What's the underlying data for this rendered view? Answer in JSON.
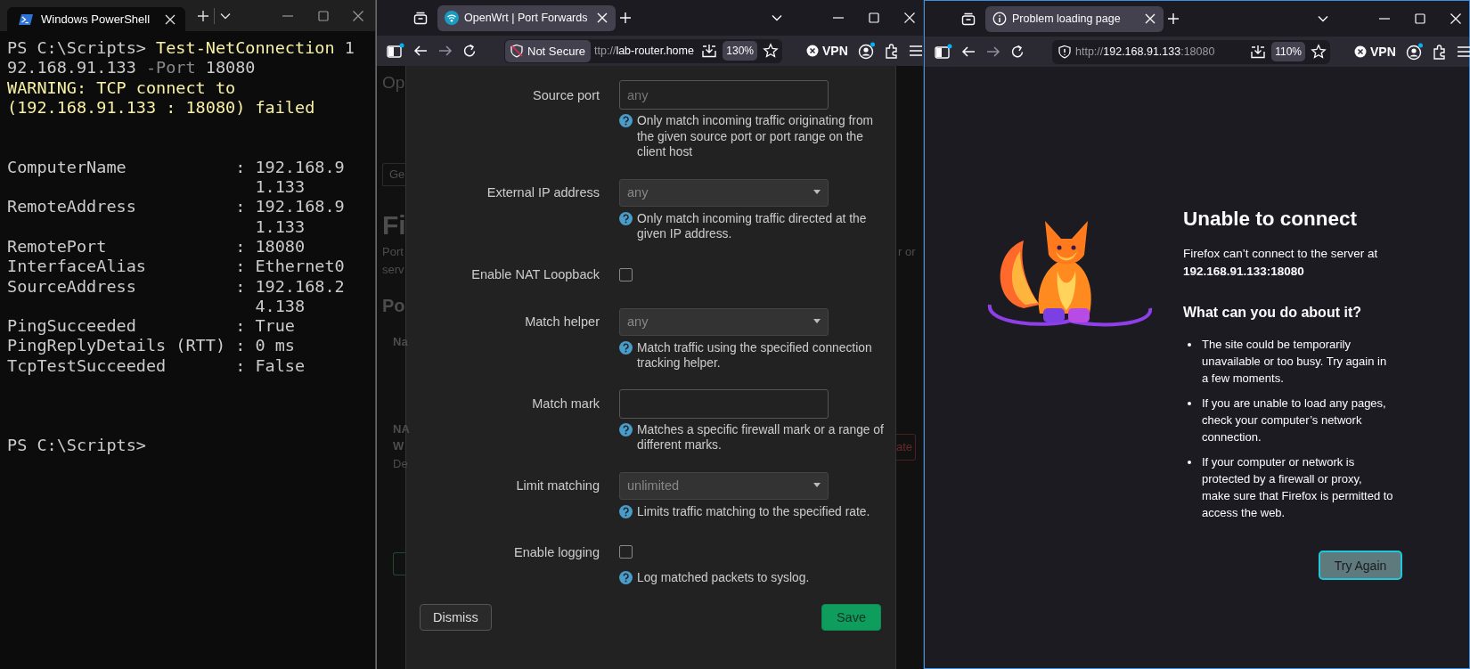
{
  "powershell_window": {
    "tab": {
      "title": "Windows PowerShell",
      "selected": true
    },
    "blocks": [
      [
        {
          "segments": [
            {
              "kind": "prompt",
              "text": "PS C:\\Scripts> "
            },
            {
              "kind": "command",
              "text": "Test-NetConnection"
            },
            {
              "kind": "argument",
              "text": " 1"
            }
          ]
        },
        {
          "segments": [
            {
              "kind": "argument",
              "text": "92.168.91.133"
            },
            {
              "kind": "parameter",
              "text": " -Port"
            },
            {
              "kind": "argument",
              "text": " 18080"
            }
          ]
        },
        {
          "segments": [
            {
              "kind": "warning",
              "text": "WARNING: TCP connect to"
            }
          ]
        },
        {
          "segments": [
            {
              "kind": "warning",
              "text": "(192.168.91.133 : 18080) failed"
            }
          ]
        }
      ],
      [
        {
          "segments": [
            {
              "kind": "output",
              "text": "ComputerName           : 192.168.9"
            }
          ]
        },
        {
          "segments": [
            {
              "kind": "output",
              "text": "                         1.133"
            }
          ]
        },
        {
          "segments": [
            {
              "kind": "output",
              "text": "RemoteAddress          : 192.168.9"
            }
          ]
        },
        {
          "segments": [
            {
              "kind": "output",
              "text": "                         1.133"
            }
          ]
        },
        {
          "segments": [
            {
              "kind": "output",
              "text": "RemotePort             : 18080"
            }
          ]
        },
        {
          "segments": [
            {
              "kind": "output",
              "text": "InterfaceAlias         : Ethernet0"
            }
          ]
        },
        {
          "segments": [
            {
              "kind": "output",
              "text": "SourceAddress          : 192.168.2"
            }
          ]
        },
        {
          "segments": [
            {
              "kind": "output",
              "text": "                         4.138"
            }
          ]
        },
        {
          "segments": [
            {
              "kind": "output",
              "text": "PingSucceeded          : True"
            }
          ]
        },
        {
          "segments": [
            {
              "kind": "output",
              "text": "PingReplyDetails (RTT) : 0 ms"
            }
          ]
        },
        {
          "segments": [
            {
              "kind": "output",
              "text": "TcpTestSucceeded       : False"
            }
          ]
        }
      ],
      [
        {
          "segments": [
            {
              "kind": "prompt",
              "text": "PS C:\\Scripts>"
            }
          ]
        }
      ]
    ]
  },
  "openwrt_browser": {
    "tab": {
      "title": "OpenWrt | Port Forwards",
      "selected": true
    },
    "security_label": "Not Secure",
    "url": [
      {
        "text": "ttp://",
        "emphasis": false
      },
      {
        "text": "lab-router.home",
        "emphasis": true
      }
    ],
    "zoom": "130%",
    "vpn": "VPN",
    "page": {
      "left_fragments": [
        {
          "kind": "heading",
          "text": "Op"
        },
        {
          "kind": "tab",
          "text": "Ge"
        },
        {
          "kind": "title",
          "text": "Fi"
        },
        {
          "kind": "text",
          "text": "Port"
        },
        {
          "kind": "text",
          "text": "serv"
        },
        {
          "kind": "subtitle",
          "text": "Po"
        },
        {
          "kind": "label",
          "text": "Na"
        },
        {
          "kind": "label",
          "text": "NA"
        },
        {
          "kind": "label",
          "text": "W"
        },
        {
          "kind": "text",
          "text": "De"
        },
        {
          "kind": "button_edge"
        }
      ],
      "right_fragments": [
        {
          "kind": "text",
          "text": "r or"
        },
        {
          "kind": "danger_button",
          "text": "ate"
        }
      ]
    },
    "dialog": {
      "fields": [
        {
          "kind": "text",
          "label": "Source port",
          "placeholder": "any",
          "help": "Only match incoming traffic originating from the given source port or port range on the client host"
        },
        {
          "kind": "select",
          "label": "External IP address",
          "value": "any",
          "help": "Only match incoming traffic directed at the given IP address."
        },
        {
          "kind": "checkbox",
          "label": "Enable NAT Loopback",
          "checked": false
        },
        {
          "kind": "select",
          "label": "Match helper",
          "value": "any",
          "help": "Match traffic using the specified connection tracking helper."
        },
        {
          "kind": "text",
          "label": "Match mark",
          "help": "Matches a specific firewall mark or a range of different marks."
        },
        {
          "kind": "select",
          "label": "Limit matching",
          "value": "unlimited",
          "help": "Limits traffic matching to the specified rate."
        },
        {
          "kind": "checkbox",
          "label": "Enable logging",
          "checked": false,
          "help": "Log matched packets to syslog."
        }
      ],
      "buttons": [
        {
          "kind": "secondary",
          "label": "Dismiss"
        },
        {
          "kind": "primary",
          "label": "Save"
        }
      ]
    }
  },
  "error_browser": {
    "tab": {
      "title": "Problem loading page",
      "selected": true
    },
    "url": [
      {
        "text": "http://",
        "emphasis": false
      },
      {
        "text": "192.168.91.133",
        "emphasis": true
      },
      {
        "text": ":18080",
        "emphasis": false
      }
    ],
    "zoom": "110%",
    "vpn": "VPN",
    "page": {
      "title": "Unable to connect",
      "message": "Firefox can’t connect to the server at **192.168.91.133:18080**",
      "subtitle": "What can you do about it?",
      "tips": [
        "The site could be temporarily unavailable or too busy. Try again in a few moments.",
        "If you are unable to load any pages, check your computer’s network connection.",
        "If your computer or network is protected by a firewall or proxy, make sure that Firefox is permitted to access the web."
      ],
      "button": "Try Again"
    }
  }
}
